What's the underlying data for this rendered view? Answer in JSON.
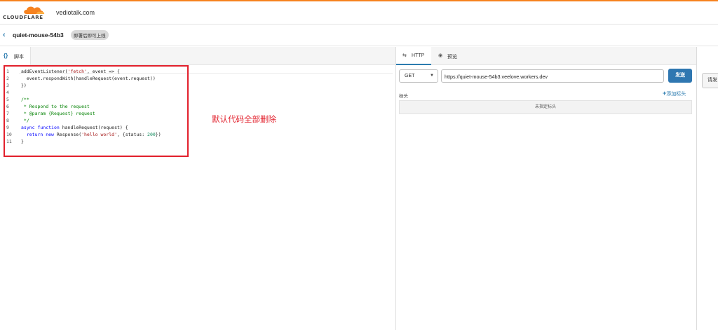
{
  "header": {
    "logo_text": "CLOUDFLARE",
    "domain": "vediotalk.com",
    "brand_color": "#f6821f"
  },
  "crumb": {
    "back_icon": "chevron-left-icon",
    "worker_name": "quiet-mouse-54b3",
    "status_badge": "即署后即可上线"
  },
  "left_panel": {
    "tab_icon": "code-braces-icon",
    "tab_icon_glyph": "{}",
    "tab_label": "脚本"
  },
  "code": {
    "lines": [
      {
        "n": "1",
        "parts": [
          {
            "t": "addEventListener(",
            "c": ""
          },
          {
            "t": "'fetch'",
            "c": "tok-str"
          },
          {
            "t": ", event => {",
            "c": ""
          }
        ]
      },
      {
        "n": "2",
        "parts": [
          {
            "t": "  event.respondWith(handleRequest(event.request))",
            "c": ""
          }
        ]
      },
      {
        "n": "3",
        "parts": [
          {
            "t": "})",
            "c": ""
          }
        ]
      },
      {
        "n": "4",
        "parts": []
      },
      {
        "n": "5",
        "parts": [
          {
            "t": "/**",
            "c": "tok-cm"
          }
        ]
      },
      {
        "n": "6",
        "parts": [
          {
            "t": " * Respond to the request",
            "c": "tok-cm"
          }
        ]
      },
      {
        "n": "7",
        "parts": [
          {
            "t": " * @param {Request} request",
            "c": "tok-cm"
          }
        ]
      },
      {
        "n": "8",
        "parts": [
          {
            "t": " */",
            "c": "tok-cm"
          }
        ]
      },
      {
        "n": "9",
        "parts": [
          {
            "t": "async function",
            "c": "tok-kw"
          },
          {
            "t": " handleRequest(request) {",
            "c": ""
          }
        ]
      },
      {
        "n": "10",
        "parts": [
          {
            "t": "  ",
            "c": ""
          },
          {
            "t": "return new",
            "c": "tok-kw"
          },
          {
            "t": " Response(",
            "c": ""
          },
          {
            "t": "'hello world'",
            "c": "tok-str"
          },
          {
            "t": ", {status: ",
            "c": ""
          },
          {
            "t": "200",
            "c": "tok-num"
          },
          {
            "t": "})",
            "c": ""
          }
        ]
      },
      {
        "n": "11",
        "parts": [
          {
            "t": "}",
            "c": ""
          }
        ]
      }
    ]
  },
  "annotation": {
    "text": "默认代码全部删除",
    "color": "#e2202c"
  },
  "right_panel": {
    "tabs": [
      {
        "label": "HTTP",
        "icon": "arrows-swap-icon",
        "glyph": "⇆"
      },
      {
        "label": "预览",
        "icon": "eye-icon",
        "glyph": "◉"
      }
    ],
    "method": "GET",
    "url": "https://quiet-mouse-54b3.veelove.workers.dev",
    "send_label": "发送",
    "headers_label": "标头",
    "add_header_label": "添加标头",
    "no_headers_text": "未指定标头",
    "accent_color": "#2f77b1"
  },
  "side_button": {
    "label": "请发"
  }
}
